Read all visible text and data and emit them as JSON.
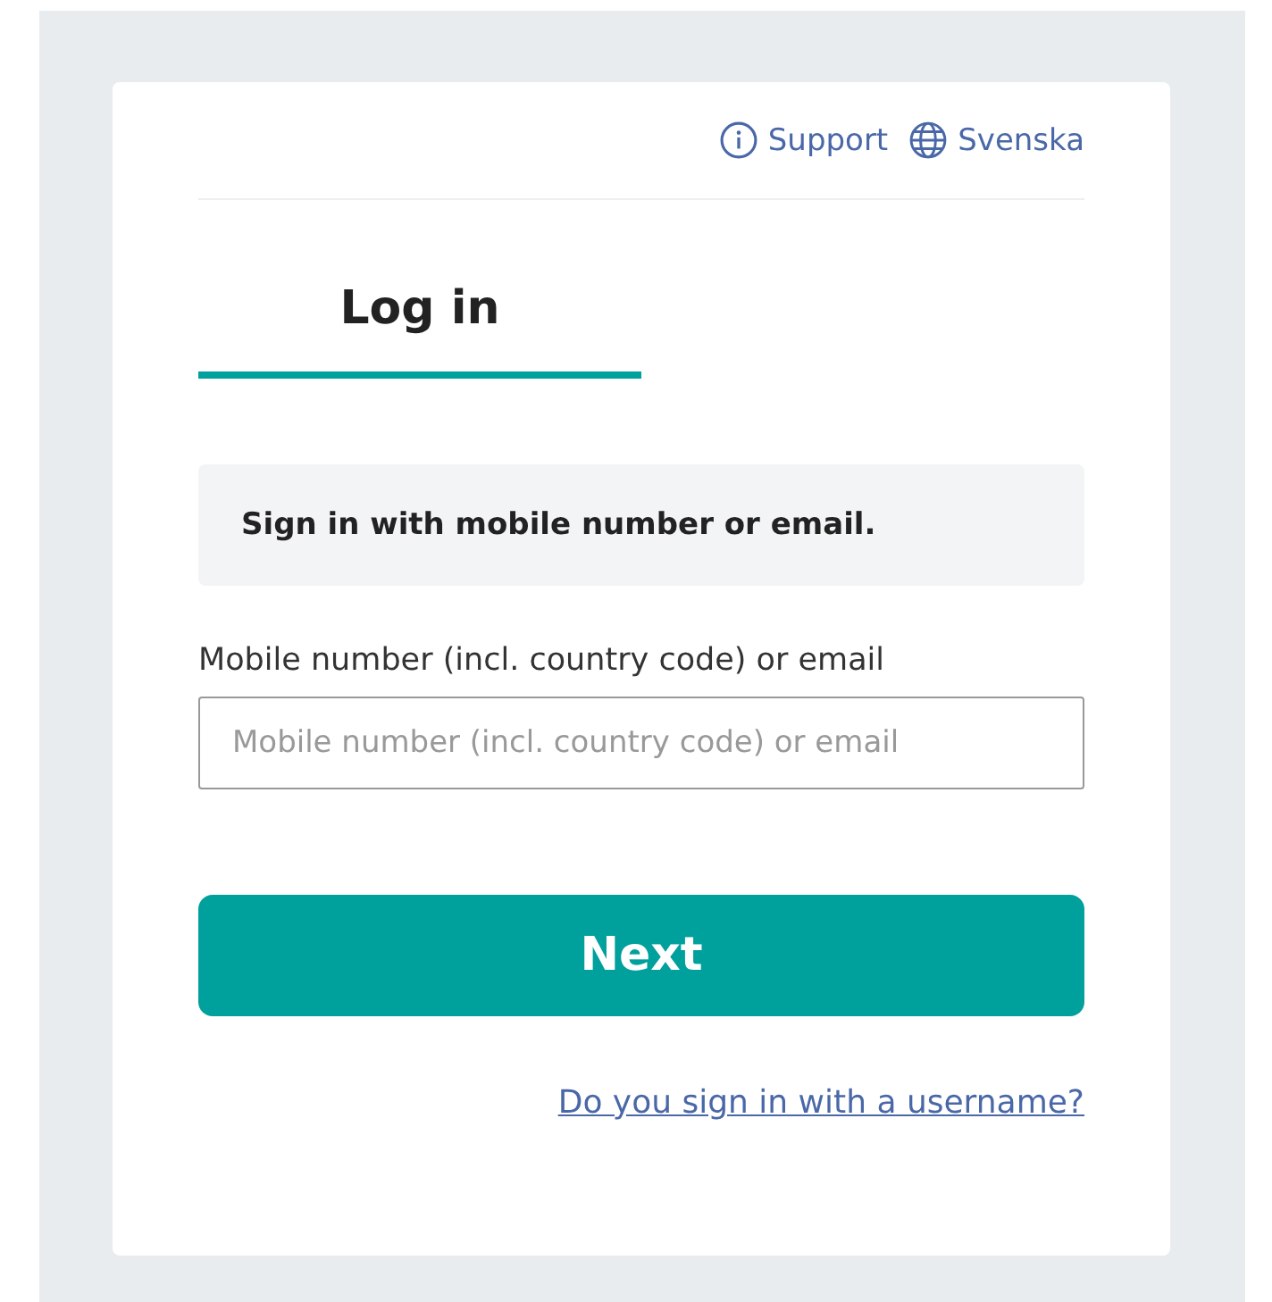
{
  "header_links": [
    {
      "kind": "info",
      "label": "Support"
    },
    {
      "kind": "globe",
      "label": "Svenska"
    }
  ],
  "tabs": [
    {
      "label": "Log in",
      "selected": true
    }
  ],
  "notice": "Sign in with mobile number or email.",
  "field": {
    "label": "Mobile number (incl. country code) or email",
    "placeholder": "Mobile number (incl. country code) or email"
  },
  "primary_button": "Next",
  "alt_link": "Do you sign in with a username?"
}
